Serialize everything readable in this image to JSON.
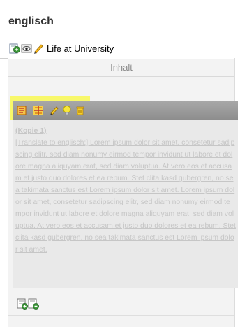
{
  "header": {
    "language_title": "englisch",
    "page_title": "Life at University",
    "page_icons": [
      "page-tree-icon",
      "view-icon",
      "edit-pencil-icon"
    ]
  },
  "column": {
    "label": "Inhalt"
  },
  "content_element": {
    "toolbar_icons": [
      "list-icon",
      "move-icon",
      "edit-pencil-icon",
      "lightbulb-icon",
      "delete-icon"
    ],
    "header_text": "(Kopie 1)",
    "body_text": "[Translate to englisch:] Lorem ipsum dolor sit amet, consetetur sadipscing elitr, sed diam nonumy eirmod tempor invidunt ut labore et dolore magna aliquyam erat, sed diam voluptua. At vero eos et accusam et justo duo dolores et ea rebum. Stet clita kasd gubergren, no sea takimata sanctus est Lorem ipsum dolor sit amet. Lorem ipsum dolor sit amet, consetetur sadipscing elitr, sed diam nonumy eirmod tempor invidunt ut labore et dolore magna aliquyam erat, sed diam voluptua. At vero eos et accusam et justo duo dolores et ea rebum. Stet clita kasd gubergren, no sea takimata sanctus est Lorem ipsum dolor sit amet."
  },
  "footer": {
    "icons": [
      "new-content-icon",
      "new-content-after-icon"
    ]
  },
  "colors": {
    "highlight": "#f8f86a",
    "toolbar": "#999999",
    "text_faded": "#c6c6c6"
  }
}
